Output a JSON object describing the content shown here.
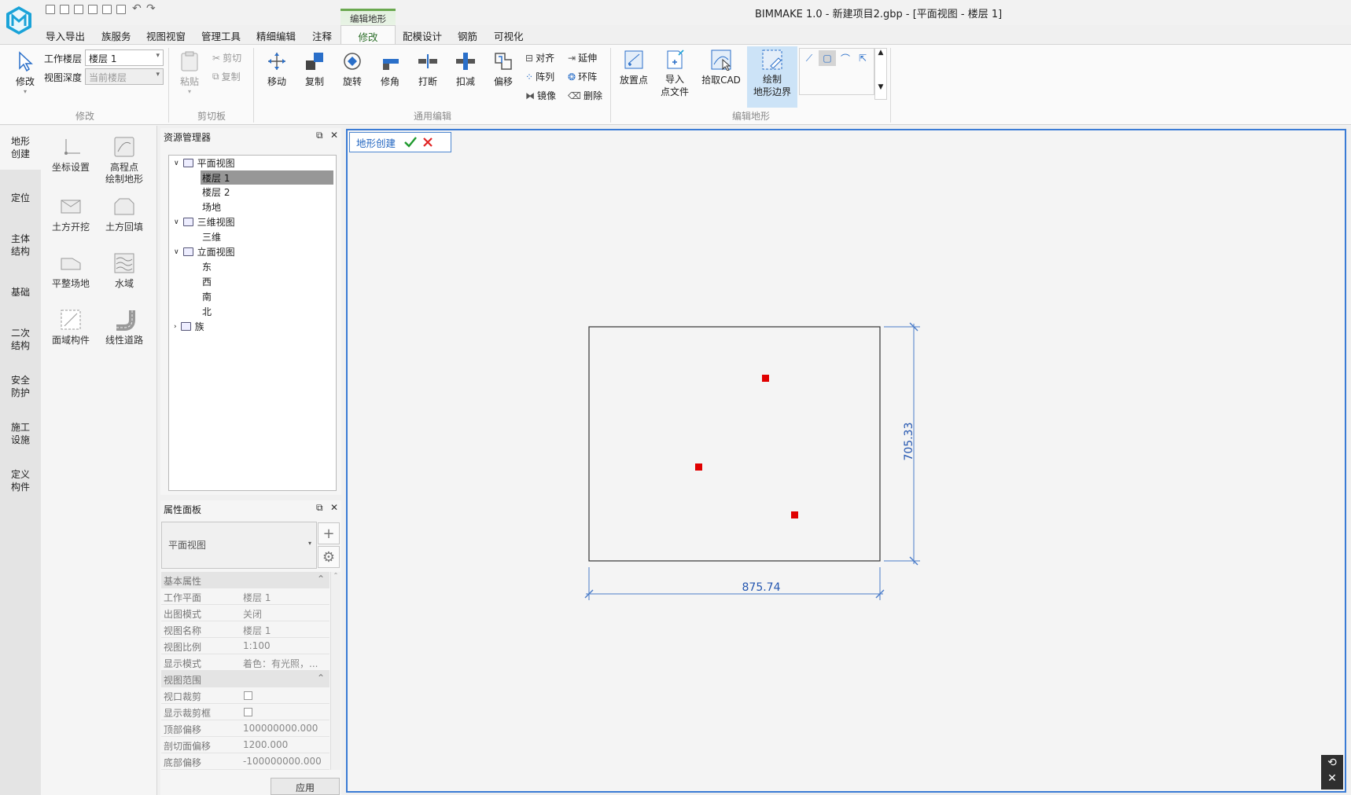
{
  "app": {
    "title": "BIMMAKE 1.0 - 新建项目2.gbp - [平面视图 - 楼层 1]"
  },
  "menu": {
    "items": [
      "导入导出",
      "族服务",
      "视图视窗",
      "管理工具",
      "精细编辑",
      "注释",
      "修改",
      "配模设计",
      "钢筋",
      "可视化"
    ],
    "context_group": "编辑地形",
    "active_tab": "修改"
  },
  "ribbon": {
    "modify_group": {
      "label": "修改",
      "modify_button": "修改",
      "work_floor_label": "工作楼层",
      "work_floor_value": "楼层 1",
      "view_depth_label": "视图深度",
      "view_depth_value": "当前楼层"
    },
    "clipboard_group": {
      "label": "剪切板",
      "paste": "粘贴",
      "cut": "剪切",
      "copy": "复制"
    },
    "general_edit_group": {
      "label": "通用编辑",
      "move": "移动",
      "copy": "复制",
      "rotate": "旋转",
      "trim": "修角",
      "break": "打断",
      "subtract": "扣减",
      "offset": "偏移",
      "align": "对齐",
      "array": "阵列",
      "mirror": "镜像",
      "extend": "延伸",
      "ring_array": "环阵",
      "delete": "删除"
    },
    "terrain_group": {
      "label": "编辑地形",
      "place_point": "放置点",
      "import_points_line1": "导入",
      "import_points_line2": "点文件",
      "pick_cad": "拾取CAD",
      "draw_boundary_line1": "绘制",
      "draw_boundary_line2": "地形边界"
    }
  },
  "vtabs": [
    "地形创建",
    "定位",
    "主体结构",
    "基础",
    "二次结构",
    "安全防护",
    "施工设施",
    "定义构件"
  ],
  "vtabs_lines": [
    [
      "地形",
      "创建"
    ],
    [
      "定位"
    ],
    [
      "主体",
      "结构"
    ],
    [
      "基础"
    ],
    [
      "二次",
      "结构"
    ],
    [
      "安全",
      "防护"
    ],
    [
      "施工",
      "设施"
    ],
    [
      "定义",
      "构件"
    ]
  ],
  "tools": [
    [
      "坐标设置"
    ],
    [
      "高程点",
      "绘制地形"
    ],
    [
      "土方开挖"
    ],
    [
      "土方回填"
    ],
    [
      "平整场地"
    ],
    [
      "水域"
    ],
    [
      "面域构件"
    ],
    [
      "线性道路"
    ]
  ],
  "resource_manager": {
    "title": "资源管理器",
    "tree": {
      "plan_views": "平面视图",
      "floor1": "楼层 1",
      "floor2": "楼层 2",
      "site": "场地",
      "views_3d": "三维视图",
      "view_3d": "三维",
      "elevations": "立面视图",
      "east": "东",
      "west": "西",
      "south": "南",
      "north": "北",
      "families": "族"
    }
  },
  "properties": {
    "title": "属性面板",
    "type": "平面视图",
    "basic_group": "基本属性",
    "view_range_group": "视图范围",
    "rows": [
      {
        "k": "工作平面",
        "v": "楼层 1"
      },
      {
        "k": "出图模式",
        "v": "关闭"
      },
      {
        "k": "视图名称",
        "v": "楼层 1"
      },
      {
        "k": "视图比例",
        "v": "1:100"
      },
      {
        "k": "显示模式",
        "v": "着色：有光照，..."
      }
    ],
    "range_rows": [
      {
        "k": "视口裁剪",
        "v": ""
      },
      {
        "k": "显示裁剪框",
        "v": ""
      },
      {
        "k": "顶部偏移",
        "v": "100000000.000"
      },
      {
        "k": "剖切面偏移",
        "v": "1200.000"
      },
      {
        "k": "底部偏移",
        "v": "-100000000.000"
      }
    ],
    "apply": "应用"
  },
  "canvas": {
    "command": "地形创建",
    "dim_width": "875.74",
    "dim_height": "705.33",
    "accent": "#3a7bd5",
    "point_color": "#e00000"
  }
}
